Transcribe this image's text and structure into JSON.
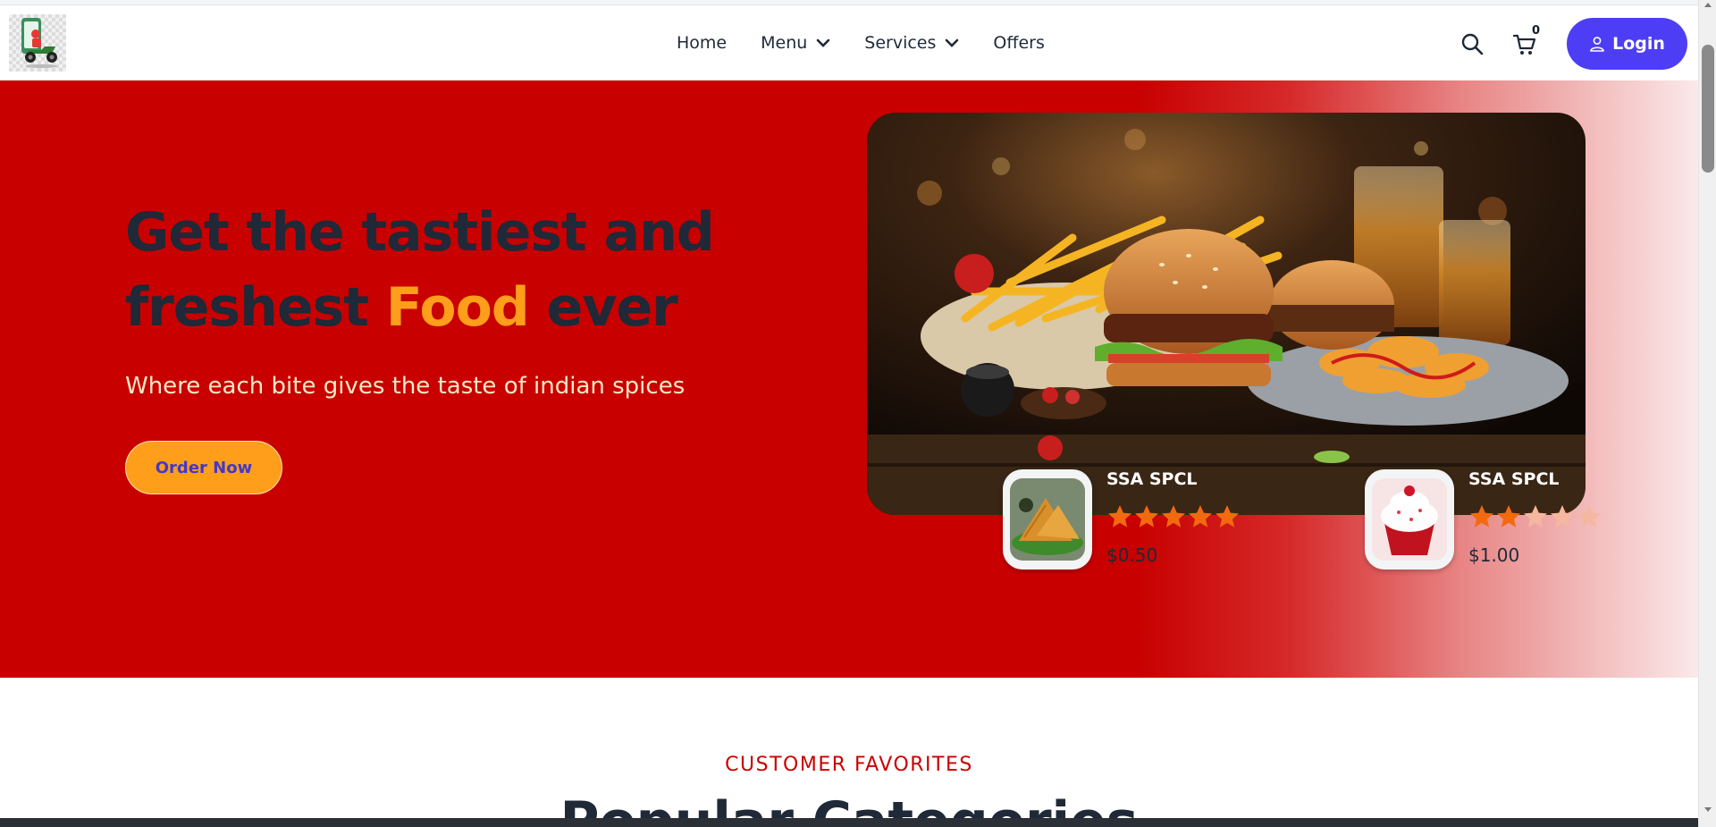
{
  "nav": {
    "links": [
      {
        "label": "Home",
        "has_dropdown": false
      },
      {
        "label": "Menu",
        "has_dropdown": true
      },
      {
        "label": "Services",
        "has_dropdown": true
      },
      {
        "label": "Offers",
        "has_dropdown": false
      }
    ],
    "cart_count": "0",
    "login_label": "Login"
  },
  "hero": {
    "title_part1": "Get the tastiest and",
    "title_part2": "freshest",
    "title_accent": "Food",
    "title_part3": "ever",
    "subtitle": "Where each bite gives the taste of indian spices",
    "cta_label": "Order Now"
  },
  "products": [
    {
      "name": "SSA SPCL",
      "rating": 5,
      "max_rating": 5,
      "price": "$0.50",
      "image": "samosa"
    },
    {
      "name": "SSA SPCL",
      "rating": 2,
      "max_rating": 5,
      "price": "$1.00",
      "image": "cupcake"
    }
  ],
  "section": {
    "kicker": "CUSTOMER FAVORITES",
    "title": "Popular Categories"
  },
  "colors": {
    "primary_red": "#c80000",
    "accent_orange": "#ff9e1b",
    "login_blue": "#4d3ef5",
    "star_filled": "#f26a10",
    "star_empty": "#f6b7a0"
  },
  "icons": {
    "search": "search-icon",
    "cart": "cart-icon",
    "user": "user-icon",
    "chevron": "chevron-down-icon"
  }
}
